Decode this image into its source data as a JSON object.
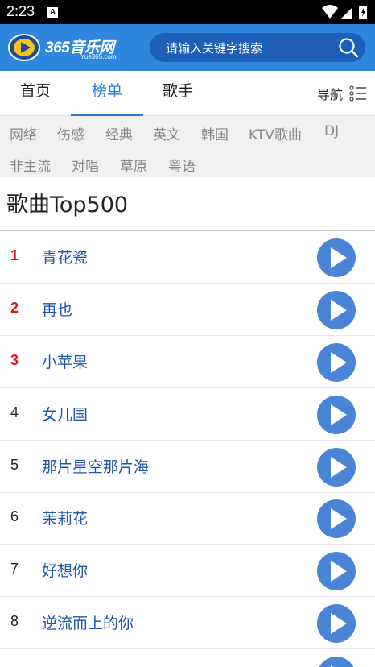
{
  "status_bar": {
    "time": "2:23",
    "notification_glyph": "A"
  },
  "header": {
    "logo_text": "365音乐网",
    "logo_sub": "Yue365.com",
    "search_placeholder": "请输入关键字搜索"
  },
  "nav": {
    "tabs": [
      {
        "label": "首页"
      },
      {
        "label": "榜单"
      },
      {
        "label": "歌手"
      }
    ],
    "menu_label": "导航"
  },
  "categories": [
    {
      "label": "网络"
    },
    {
      "label": "伤感"
    },
    {
      "label": "经典"
    },
    {
      "label": "英文"
    },
    {
      "label": "韩国"
    },
    {
      "label": "KTV歌曲"
    },
    {
      "label": "DJ"
    },
    {
      "label": "非主流"
    },
    {
      "label": "对唱"
    },
    {
      "label": "草原"
    },
    {
      "label": "粤语"
    }
  ],
  "list_title": "歌曲Top500",
  "songs": [
    {
      "rank": "1",
      "name": "青花瓷"
    },
    {
      "rank": "2",
      "name": "再也"
    },
    {
      "rank": "3",
      "name": "小苹果"
    },
    {
      "rank": "4",
      "name": "女儿国"
    },
    {
      "rank": "5",
      "name": "那片星空那片海"
    },
    {
      "rank": "6",
      "name": "茉莉花"
    },
    {
      "rank": "7",
      "name": "好想你"
    },
    {
      "rank": "8",
      "name": "逆流而上的你"
    }
  ],
  "colors": {
    "accent": "#2f87dd",
    "rank_top": "#e8101a",
    "song_link": "#1f56a8",
    "play_button": "#4a84d6"
  }
}
